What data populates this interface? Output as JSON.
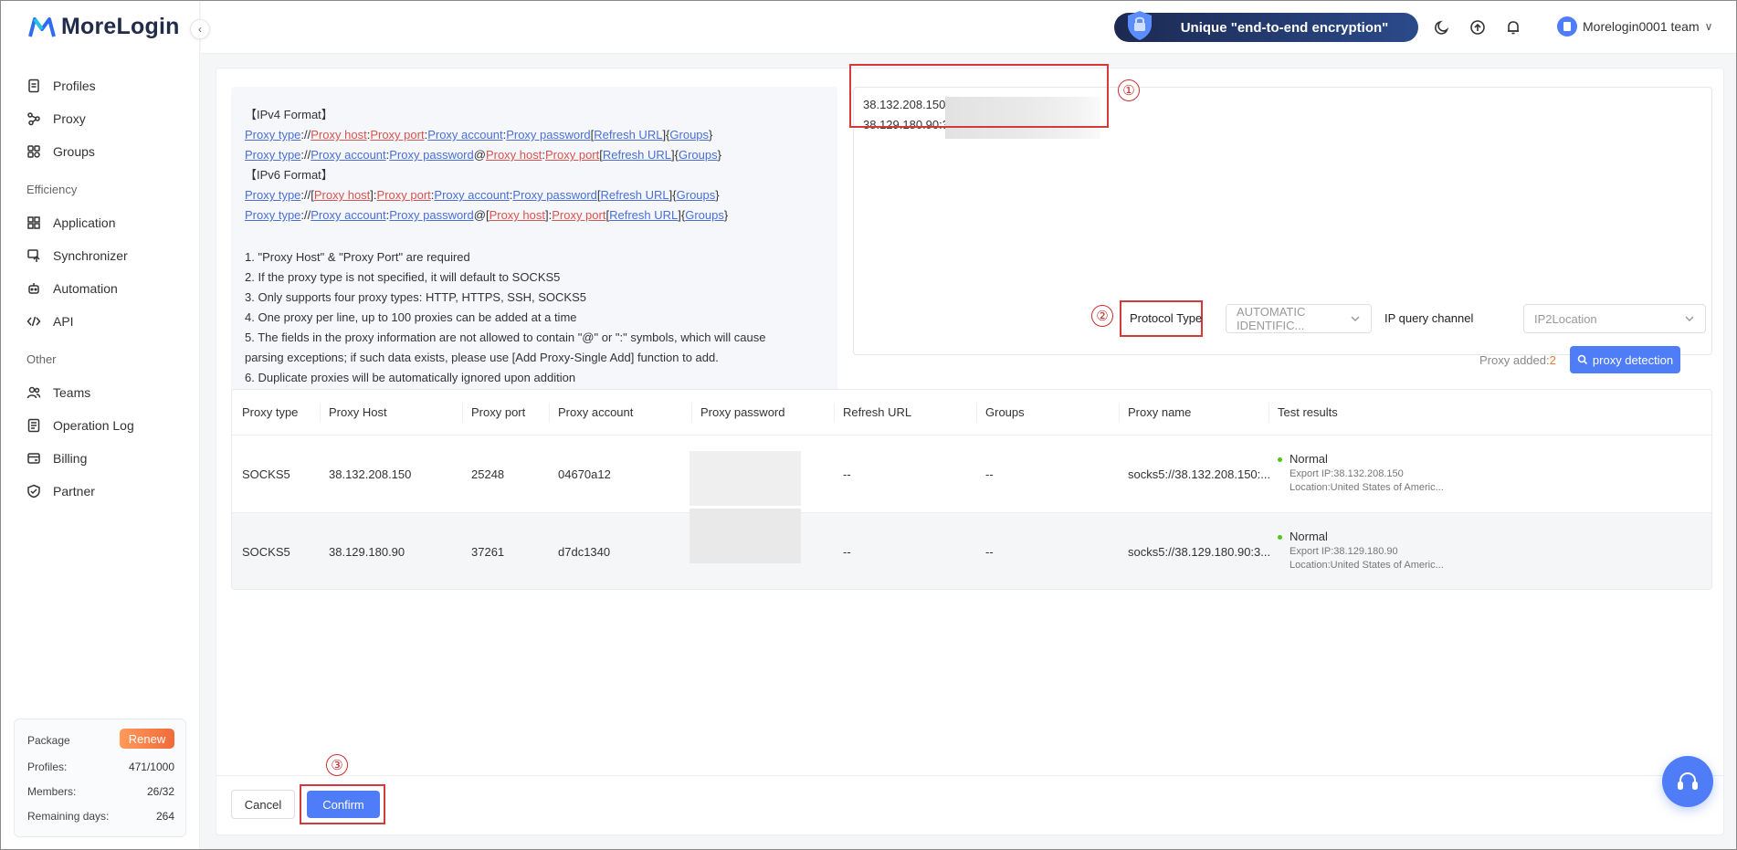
{
  "app": {
    "name": "MoreLogin"
  },
  "header": {
    "promo_text": "Unique \"end-to-end encryption\"",
    "user_name": "Morelogin0001 team"
  },
  "sidebar": {
    "items_top": [
      {
        "label": "Profiles",
        "icon": "profile-icon"
      },
      {
        "label": "Proxy",
        "icon": "proxy-icon"
      },
      {
        "label": "Groups",
        "icon": "groups-icon"
      }
    ],
    "efficiency_title": "Efficiency",
    "items_efficiency": [
      {
        "label": "Application",
        "icon": "application-icon"
      },
      {
        "label": "Synchronizer",
        "icon": "synchronizer-icon"
      },
      {
        "label": "Automation",
        "icon": "automation-icon"
      },
      {
        "label": "API",
        "icon": "api-icon"
      }
    ],
    "other_title": "Other",
    "items_other": [
      {
        "label": "Teams",
        "icon": "teams-icon"
      },
      {
        "label": "Operation Log",
        "icon": "operation-log-icon"
      },
      {
        "label": "Billing",
        "icon": "billing-icon"
      },
      {
        "label": "Partner",
        "icon": "partner-icon"
      }
    ],
    "package": {
      "label": "Package",
      "renew_label": "Renew",
      "profiles_label": "Profiles:",
      "profiles_value": "471/1000",
      "members_label": "Members:",
      "members_value": "26/32",
      "remaining_label": "Remaining days:",
      "remaining_value": "264"
    }
  },
  "format_help": {
    "ipv4_title": "【IPv4 Format】",
    "ipv6_title": "【IPv6 Format】",
    "notes": [
      "1. \"Proxy Host\" & \"Proxy Port\" are required",
      "2. If the proxy type is not specified, it will default to SOCKS5",
      "3. Only supports four proxy types: HTTP, HTTPS, SSH, SOCKS5",
      "4. One proxy per line, up to 100 proxies can be added at a time",
      "5. The fields in the proxy information are not allowed to contain \"@\" or \":\" symbols, which will cause",
      "parsing exceptions; if such data exists, please use [Add Proxy-Single Add] function to add.",
      "6. Duplicate proxies will be automatically ignored upon addition"
    ],
    "tokens": {
      "type": "Proxy type",
      "host": "Proxy host",
      "port": "Proxy port",
      "account": "Proxy account",
      "password": "Proxy password",
      "refresh": "Refresh URL",
      "groups": "Groups"
    }
  },
  "input": {
    "lines": [
      "38.132.208.150:",
      "38.129.180.90:3"
    ]
  },
  "annotations": {
    "n1": "①",
    "n2": "②",
    "n3": "③"
  },
  "controls": {
    "protocol_label": "Protocol Type",
    "protocol_value": "AUTOMATIC IDENTIFIC...",
    "ip_channel_label": "IP query channel",
    "ip_channel_value": "IP2Location",
    "proxy_added_label": "Proxy added:",
    "proxy_added_count": "2",
    "detect_label": "proxy detection"
  },
  "table": {
    "columns": [
      "Proxy type",
      "Proxy Host",
      "Proxy port",
      "Proxy account",
      "Proxy password",
      "Refresh URL",
      "Groups",
      "Proxy name",
      "Test results"
    ],
    "rows": [
      {
        "type": "SOCKS5",
        "host": "38.132.208.150",
        "port": "25248",
        "account": "04670a12",
        "refresh": "--",
        "groups": "--",
        "name": "socks5://38.132.208.150:...",
        "status": "Normal",
        "export_ip": "Export IP:38.132.208.150",
        "location": "Location:United States of Americ..."
      },
      {
        "type": "SOCKS5",
        "host": "38.129.180.90",
        "port": "37261",
        "account": "d7dc1340",
        "refresh": "--",
        "groups": "--",
        "name": "socks5://38.129.180.90:3...",
        "status": "Normal",
        "export_ip": "Export IP:38.129.180.90",
        "location": "Location:United States of Americ..."
      }
    ]
  },
  "footer": {
    "cancel_label": "Cancel",
    "confirm_label": "Confirm"
  },
  "colors": {
    "accent": "#4f7cf7",
    "annotation_red": "#d43a3a",
    "renew_orange": "#f26a3a"
  }
}
